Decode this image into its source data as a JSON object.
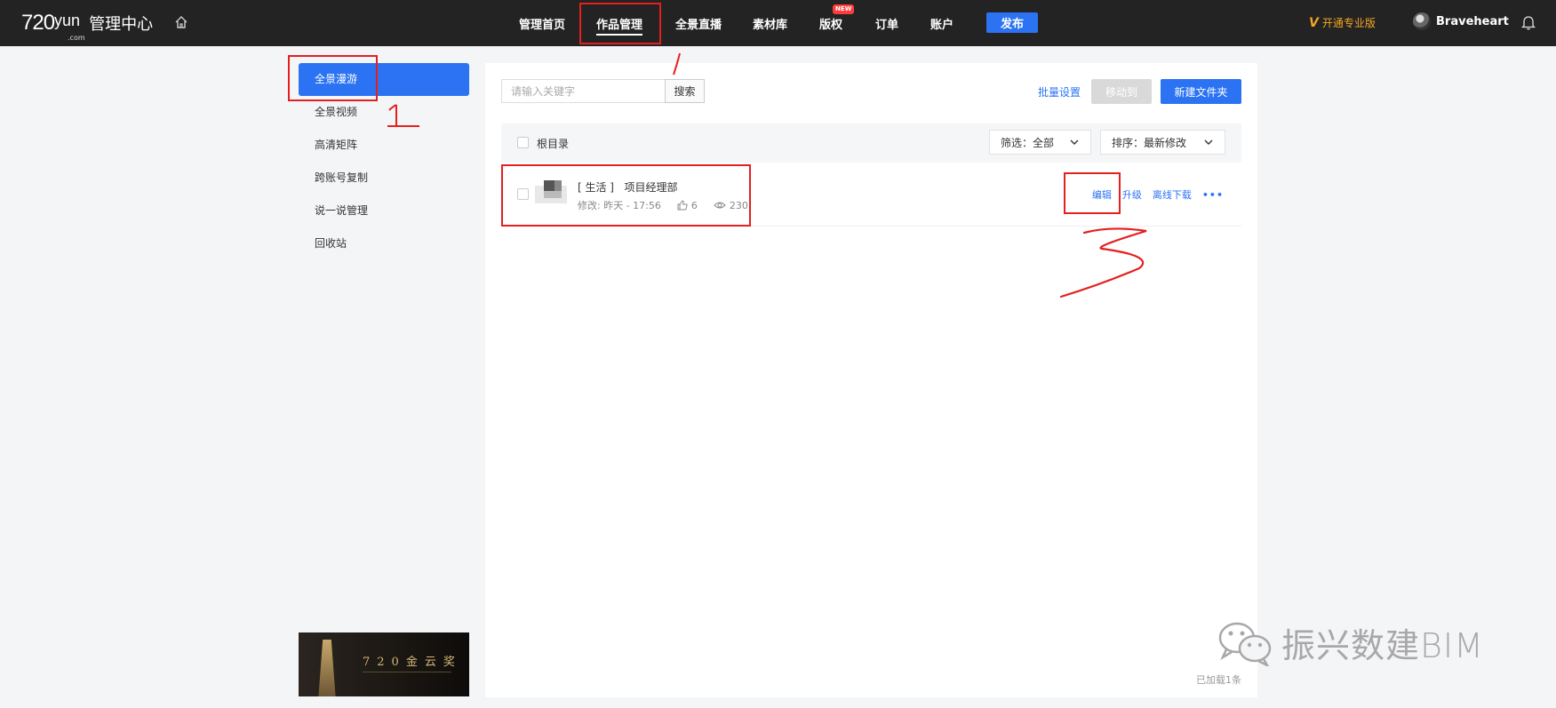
{
  "header": {
    "logo_num": "720",
    "logo_yun": "yun",
    "logo_com": ".com",
    "logo_title": "管理中心",
    "nav": [
      {
        "label": "管理首页"
      },
      {
        "label": "作品管理"
      },
      {
        "label": "全景直播"
      },
      {
        "label": "素材库"
      },
      {
        "label": "版权"
      },
      {
        "label": "订单"
      },
      {
        "label": "账户"
      }
    ],
    "new_badge": "NEW",
    "publish_label": "发布",
    "vip_mark": "V",
    "vip_label": "开通专业版",
    "username": "Braveheart"
  },
  "sidebar": {
    "items": [
      {
        "label": "全景漫游"
      },
      {
        "label": "全景视频"
      },
      {
        "label": "高清矩阵"
      },
      {
        "label": "跨账号复制"
      },
      {
        "label": "说一说管理"
      },
      {
        "label": "回收站"
      }
    ],
    "banner_title": "720金云奖"
  },
  "main": {
    "search_placeholder": "请输入关键字",
    "search_button": "搜索",
    "batch_settings": "批量设置",
    "move_to": "移动到",
    "new_folder": "新建文件夹",
    "root_label": "根目录",
    "filter_label": "筛选：全部",
    "sort_label": "排序：最新修改",
    "works": [
      {
        "category": "[ 生活 ]",
        "title": "项目经理部",
        "modified": "修改: 昨天 - 17:56",
        "likes": "6",
        "views": "230",
        "actions": [
          "编辑",
          "升级",
          "离线下载",
          "•••"
        ]
      }
    ],
    "loaded_text": "已加载1条"
  },
  "annotations": {
    "mark_1": "1",
    "mark_2": "/",
    "mark_3": "3",
    "color": "#e4201f"
  },
  "watermark": {
    "text": "振兴数建BIM"
  },
  "colors": {
    "accent": "#2b73f2",
    "topbar": "#232323",
    "vip": "#f5a623"
  }
}
